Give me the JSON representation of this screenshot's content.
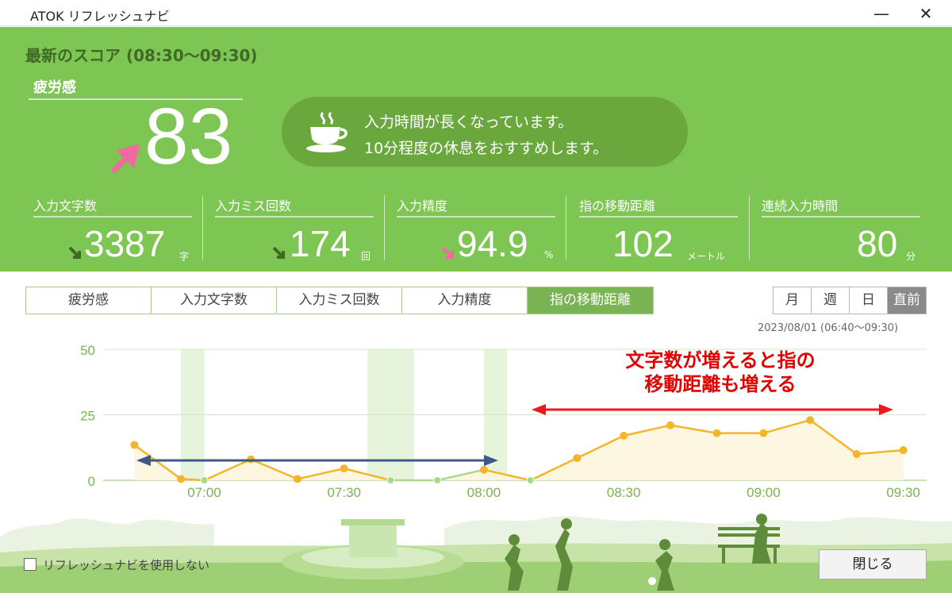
{
  "window": {
    "title": "ATOK リフレッシュナビ",
    "minimize_glyph": "—",
    "close_glyph": "✕"
  },
  "score": {
    "title": "最新のスコア (08:30～09:30)",
    "fatigue_label": "疲労感",
    "fatigue_value": "83",
    "fatigue_trend": "up"
  },
  "message": {
    "line1": "入力時間が長くなっています。",
    "line2": "10分程度の休息をおすすめします。",
    "icon": "coffee-cup-icon"
  },
  "stats": [
    {
      "label": "入力文字数",
      "value": "3387",
      "unit": "字",
      "trend": "down"
    },
    {
      "label": "入力ミス回数",
      "value": "174",
      "unit": "回",
      "trend": "down"
    },
    {
      "label": "入力精度",
      "value": "94.9",
      "unit": "%",
      "trend": "down"
    },
    {
      "label": "指の移動距離",
      "value": "102",
      "unit": "メートル",
      "trend": "none"
    },
    {
      "label": "連続入力時間",
      "value": "80",
      "unit": "分",
      "trend": "none"
    }
  ],
  "tabs": [
    "疲労感",
    "入力文字数",
    "入力ミス回数",
    "入力精度",
    "指の移動距離"
  ],
  "active_tab": 4,
  "periods": [
    "月",
    "週",
    "日",
    "直前"
  ],
  "active_period": 3,
  "date_range": "2023/08/01 (06:40～09:30)",
  "colors": {
    "header_green": "#7ec653",
    "line_orange": "#f5b52a",
    "line_green": "#a8d98a",
    "fill_yellow": "#fdf5dd",
    "annotation_red": "#e00000",
    "annotation_arrow_red": "#e8191f",
    "annotation_arrow_blue": "#3b5a8a",
    "up_pink": "#f06aa0"
  },
  "chart_data": {
    "type": "line",
    "ylim": [
      0,
      50
    ],
    "y_ticks": [
      "0",
      "25",
      "50"
    ],
    "x_ticks": [
      "07:00",
      "07:30",
      "08:00",
      "08:30",
      "09:00",
      "09:30"
    ],
    "series": [
      {
        "x": [
          "06:45",
          "06:50",
          "06:55",
          "07:00",
          "07:05",
          "07:10",
          "07:15",
          "07:20",
          "07:25",
          "07:30",
          "07:35",
          "07:40",
          "07:45",
          "07:50",
          "07:55",
          "08:00",
          "08:05",
          "08:10",
          "08:15",
          "08:20",
          "08:25",
          "08:30",
          "08:35",
          "08:40",
          "08:45",
          "08:50",
          "08:55",
          "09:00",
          "09:05",
          "09:10",
          "09:15",
          "09:20",
          "09:25",
          "09:30"
        ],
        "values": [
          13.5,
          null,
          0.5,
          0,
          null,
          8,
          null,
          0.5,
          null,
          4.5,
          null,
          0,
          null,
          0,
          null,
          4,
          null,
          0,
          null,
          8.5,
          null,
          17,
          null,
          21,
          null,
          18,
          null,
          18,
          null,
          23,
          null,
          10,
          null,
          11.5
        ]
      }
    ],
    "break_periods": [
      [
        "06:55",
        "07:00"
      ],
      [
        "07:35",
        "07:45"
      ],
      [
        "08:00",
        "08:05"
      ]
    ],
    "annotations": [
      {
        "text_line1": "文字数が増えると指の",
        "text_line2": "移動距離も増える"
      }
    ]
  },
  "footer": {
    "checkbox_label": "リフレッシュナビを使用しない",
    "close_label": "閉じる"
  }
}
